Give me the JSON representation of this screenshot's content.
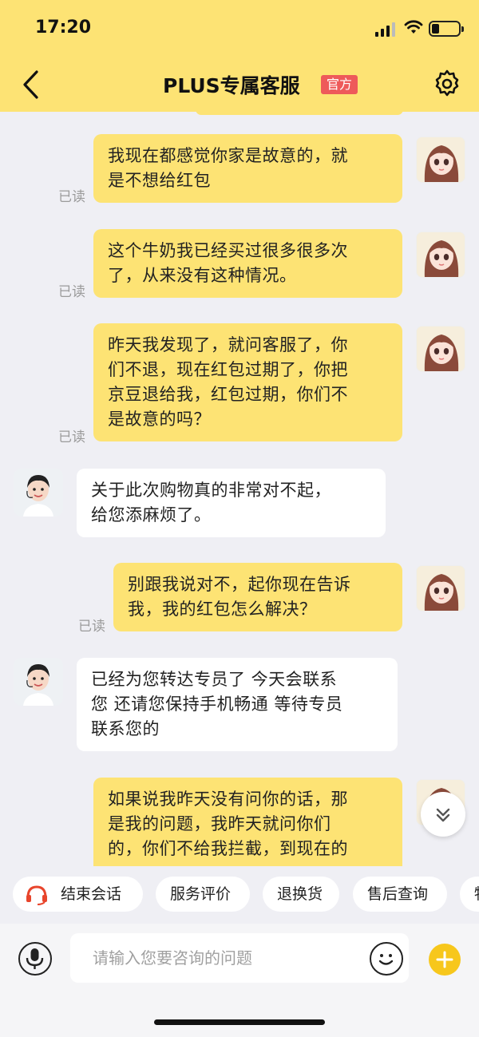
{
  "status_bar": {
    "time": "17:20"
  },
  "header": {
    "title": "PLUS专属客服",
    "badge": "官方"
  },
  "messages": [
    {
      "from": "user",
      "text_lines": [
        "我现在都感觉你家是故意的，就",
        "是不想给红包"
      ],
      "read": "已读"
    },
    {
      "from": "user",
      "text_lines": [
        "这个牛奶我已经买过很多很多次",
        "了，从来没有这种情况。"
      ],
      "read": "已读"
    },
    {
      "from": "user",
      "text_lines": [
        "昨天我发现了，就问客服了，你",
        "们不退，现在红包过期了，你把",
        "京豆退给我，红包过期，你们不",
        "是故意的吗？"
      ],
      "read": "已读"
    },
    {
      "from": "agent",
      "text_lines": [
        "关于此次购物真的非常对不起，",
        "给您添麻烦了。"
      ]
    },
    {
      "from": "user",
      "text_lines": [
        "别跟我说对不，起你现在告诉",
        "我，我的红包怎么解决？"
      ],
      "read": "已读"
    },
    {
      "from": "agent",
      "text_lines": [
        "已经为您转达专员了 今天会联系",
        "您 还请您保持手机畅通 等待专员",
        "联系您的"
      ]
    },
    {
      "from": "user",
      "text_lines": [
        "如果说我昨天没有问你的话，那",
        "是我的问题，我昨天就问你们",
        "的，你们不给我拦截，到现在的"
      ]
    }
  ],
  "quick_replies": [
    "结束会话",
    "服务评价",
    "退换货",
    "售后查询",
    "物"
  ],
  "input": {
    "placeholder": "请输入您要咨询的问题"
  },
  "colors": {
    "header_bg": "#fde374",
    "user_bubble": "#fde374",
    "agent_bubble": "#ffffff",
    "badge_bg": "#ee5a5a",
    "plus_button": "#f7c71c",
    "page_bg": "#efeff4"
  },
  "icons": [
    "back-icon",
    "settings-icon",
    "headset-icon",
    "mic-icon",
    "emoji-icon",
    "plus-icon",
    "chevron-double-down-icon"
  ]
}
